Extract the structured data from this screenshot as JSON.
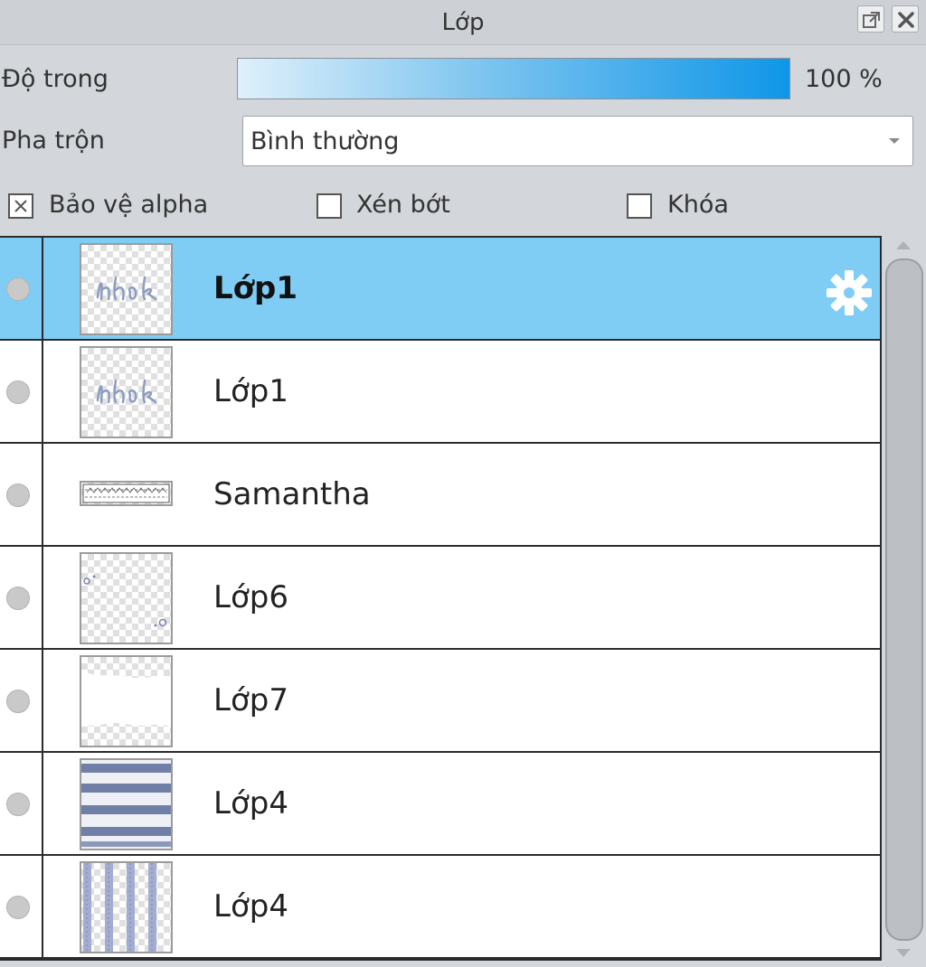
{
  "panel": {
    "title": "Lớp"
  },
  "controls": {
    "opacity_label": "Độ trong",
    "opacity_value": "100 %",
    "opacity_fraction": 1.0,
    "blend_label": "Pha trộn",
    "blend_value": "Bình thường",
    "protect_alpha_label": "Bảo vệ alpha",
    "protect_alpha_checked": true,
    "clipping_label": "Xén bớt",
    "clipping_checked": false,
    "lock_label": "Khóa",
    "lock_checked": false
  },
  "layers": [
    {
      "name": "Lớp1",
      "selected": true,
      "thumbnail": "handwriting-text"
    },
    {
      "name": "Lớp1",
      "selected": false,
      "thumbnail": "handwriting-text"
    },
    {
      "name": "Samantha",
      "selected": false,
      "thumbnail": "lace-border"
    },
    {
      "name": "Lớp6",
      "selected": false,
      "thumbnail": "corner-dots"
    },
    {
      "name": "Lớp7",
      "selected": false,
      "thumbnail": "white-frame"
    },
    {
      "name": "Lớp4",
      "selected": false,
      "thumbnail": "horizontal-stripes"
    },
    {
      "name": "Lớp4",
      "selected": false,
      "thumbnail": "vertical-stripes"
    }
  ],
  "icons": {
    "popout": "popout-icon",
    "close": "close-icon",
    "layer_settings": "gear-icon"
  },
  "colors": {
    "selected_row": "#7fcdf5",
    "slider_end": "#0f96e8",
    "stripe": "#6f7fa6"
  }
}
